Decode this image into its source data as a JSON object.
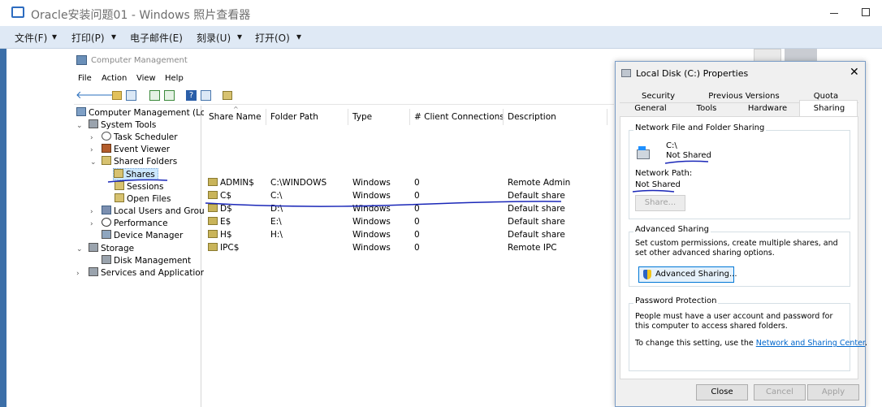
{
  "viewer": {
    "title": "Oracle安装问题01 - Windows 照片查看器",
    "menu": [
      "文件(F)",
      "打印(P)",
      "电子邮件(E)",
      "刻录(U)",
      "打开(O)"
    ]
  },
  "cm": {
    "title": "Computer Management",
    "menu": [
      "File",
      "Action",
      "View",
      "Help"
    ],
    "tree": [
      {
        "label": "Computer Management (Local",
        "arrow": ""
      },
      {
        "label": "System Tools",
        "arrow": "v"
      },
      {
        "label": "Task Scheduler",
        "arrow": ">"
      },
      {
        "label": "Event Viewer",
        "arrow": ">"
      },
      {
        "label": "Shared Folders",
        "arrow": "v"
      },
      {
        "label": "Shares",
        "arrow": ""
      },
      {
        "label": "Sessions",
        "arrow": ""
      },
      {
        "label": "Open Files",
        "arrow": ""
      },
      {
        "label": "Local Users and Groups",
        "arrow": ">"
      },
      {
        "label": "Performance",
        "arrow": ">"
      },
      {
        "label": "Device Manager",
        "arrow": ""
      },
      {
        "label": "Storage",
        "arrow": "v"
      },
      {
        "label": "Disk Management",
        "arrow": ""
      },
      {
        "label": "Services and Applications",
        "arrow": ">"
      }
    ],
    "columns": [
      "Share Name",
      "Folder Path",
      "Type",
      "# Client Connections",
      "Description"
    ],
    "rows": [
      [
        "ADMIN$",
        "C:\\WINDOWS",
        "Windows",
        "0",
        "Remote Admin"
      ],
      [
        "C$",
        "C:\\",
        "Windows",
        "0",
        "Default share"
      ],
      [
        "D$",
        "D:\\",
        "Windows",
        "0",
        "Default share"
      ],
      [
        "E$",
        "E:\\",
        "Windows",
        "0",
        "Default share"
      ],
      [
        "H$",
        "H:\\",
        "Windows",
        "0",
        "Default share"
      ],
      [
        "IPC$",
        "",
        "Windows",
        "0",
        "Remote IPC"
      ]
    ]
  },
  "props": {
    "title": "Local Disk (C:) Properties",
    "tabs_row1": [
      "Security",
      "Previous Versions",
      "Quota"
    ],
    "tabs_row2": [
      "General",
      "Tools",
      "Hardware",
      "Sharing"
    ],
    "nffs": {
      "title": "Network File and Folder Sharing",
      "drive": "C:\\",
      "status": "Not Shared",
      "path_label": "Network Path:",
      "path_value": "Not Shared",
      "share_btn": "Share..."
    },
    "adv": {
      "title": "Advanced Sharing",
      "text": "Set custom permissions, create multiple shares, and set other advanced sharing options.",
      "btn": "Advanced Sharing..."
    },
    "pwd": {
      "title": "Password Protection",
      "text": "People must have a user account and password for this computer to access shared folders.",
      "change_prefix": "To change this setting, use the ",
      "link": "Network and Sharing Center",
      "change_suffix": "."
    },
    "buttons": {
      "close": "Close",
      "cancel": "Cancel",
      "apply": "Apply"
    }
  }
}
